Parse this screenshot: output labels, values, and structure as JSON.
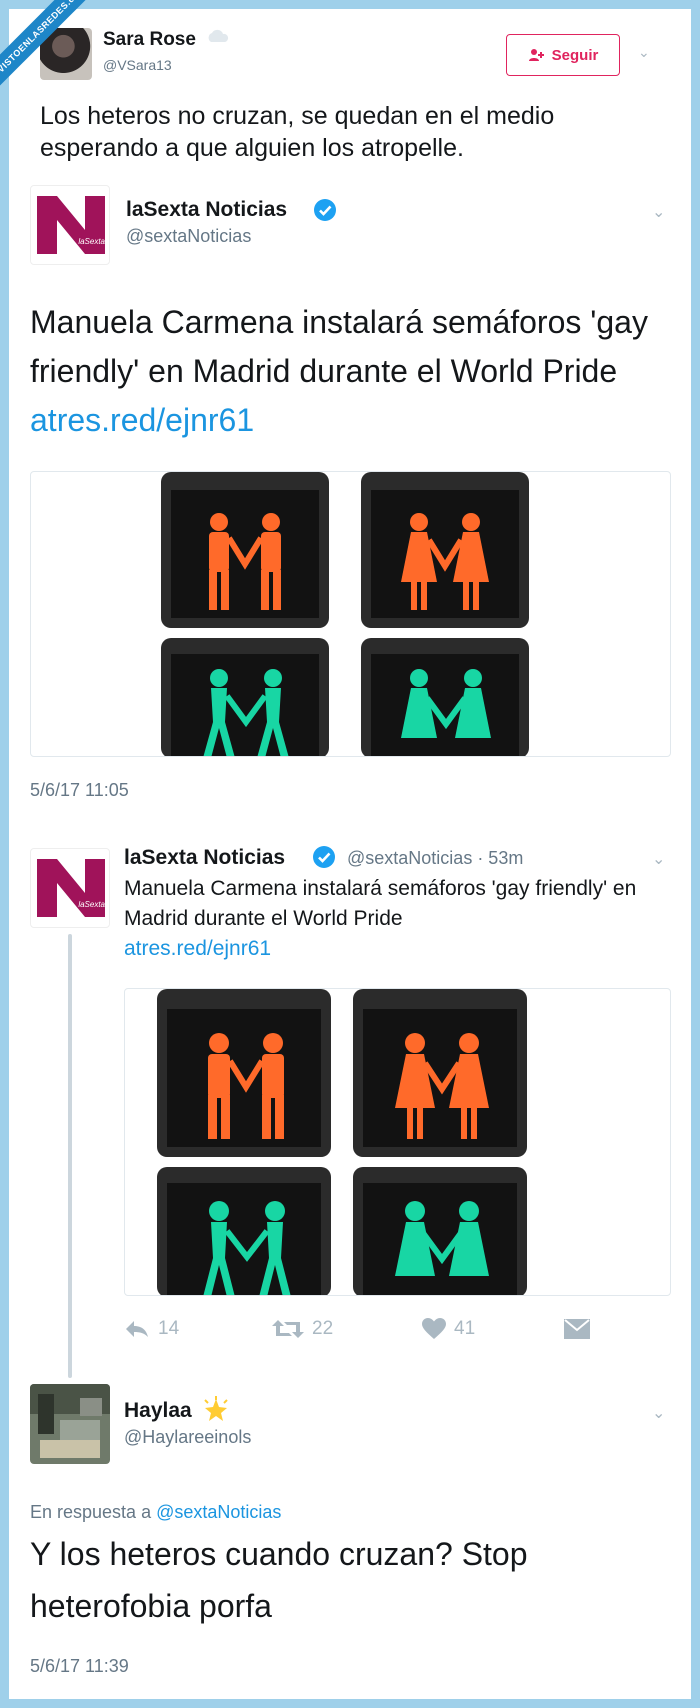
{
  "watermark": "VISTOENLASREDES.com",
  "colors": {
    "frame": "#9fd0ea",
    "follow": "#e0245e",
    "link": "#1b95e0",
    "verified": "#1da1f2",
    "muted": "#657786",
    "brand_logo": "#a0135a"
  },
  "top_tweet": {
    "name": "Sara Rose",
    "handle": "@VSara13",
    "follow_label": "Seguir",
    "text": "Los heteros no cruzan, se quedan en el medio esperando a que alguien los atropelle."
  },
  "quoted_tweet": {
    "logo_text": "laSexta",
    "name": "laSexta Noticias",
    "handle": "@sextaNoticias",
    "text": "Manuela Carmena instalará semáforos 'gay friendly' en Madrid durante el World Pride",
    "link": "atres.red/ejnr61",
    "date": "5/6/17 11:05"
  },
  "conversation_tweet": {
    "name": "laSexta Noticias",
    "meta": "@sextaNoticias · 53m",
    "text": "Manuela Carmena instalará semáforos 'gay friendly' en Madrid durante el World Pride",
    "link": "atres.red/ejnr61",
    "actions": {
      "reply": "14",
      "retweet": "22",
      "like": "41"
    }
  },
  "reply_tweet": {
    "name": "Haylaa",
    "handle": "@Haylareeinols",
    "reply_prefix": "En respuesta a",
    "reply_to": "@sextaNoticias",
    "text": "Y los heteros cuando cruzan? Stop heterofobia porfa",
    "date": "5/6/17 11:39"
  }
}
